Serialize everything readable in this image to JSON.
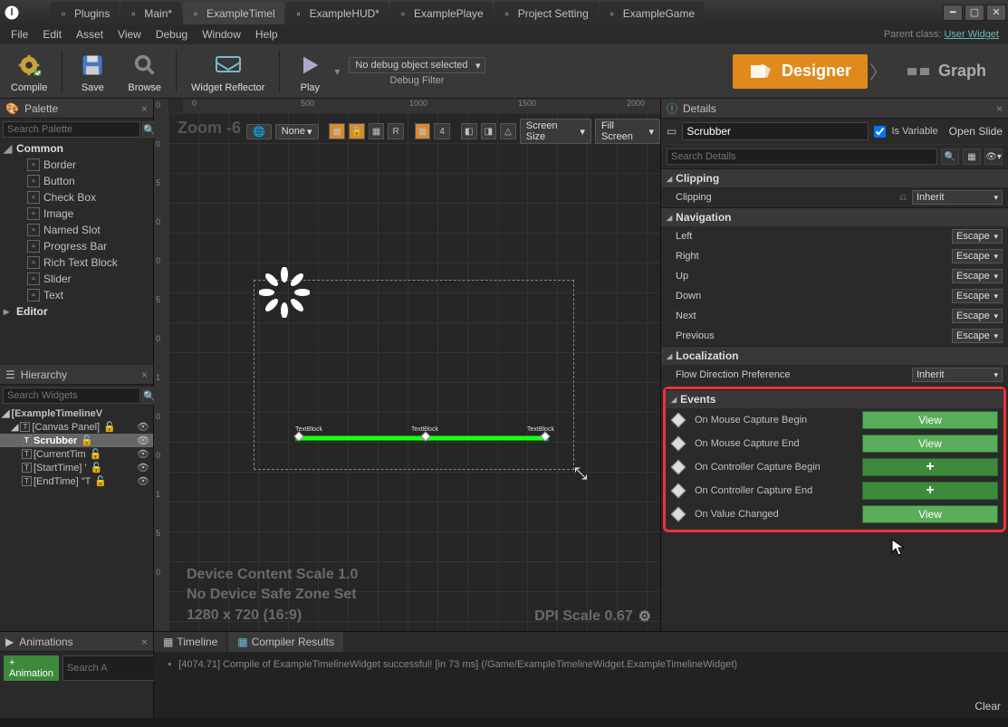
{
  "titlebar": {
    "tabs": [
      {
        "label": "Plugins",
        "icon": "plugin"
      },
      {
        "label": "Main*",
        "icon": "level"
      },
      {
        "label": "ExampleTimel",
        "icon": "widget",
        "active": true
      },
      {
        "label": "ExampleHUD*",
        "icon": "widget"
      },
      {
        "label": "ExamplePlaye",
        "icon": "bp"
      },
      {
        "label": "Project Setting",
        "icon": "settings"
      },
      {
        "label": "ExampleGame",
        "icon": "bp"
      }
    ]
  },
  "menus": [
    "File",
    "Edit",
    "Asset",
    "View",
    "Debug",
    "Window",
    "Help"
  ],
  "parent_class_label": "Parent class:",
  "parent_class": "User Widget",
  "toolbar": {
    "compile": "Compile",
    "save": "Save",
    "browse": "Browse",
    "reflector": "Widget Reflector",
    "play": "Play",
    "debug_select": "No debug object selected",
    "debug_filter": "Debug Filter",
    "designer": "Designer",
    "graph": "Graph"
  },
  "palette": {
    "title": "Palette",
    "search_placeholder": "Search Palette",
    "category": "Common",
    "items": [
      "Border",
      "Button",
      "Check Box",
      "Image",
      "Named Slot",
      "Progress Bar",
      "Rich Text Block",
      "Slider",
      "Text"
    ],
    "editor": "Editor"
  },
  "hierarchy": {
    "title": "Hierarchy",
    "search_placeholder": "Search Widgets",
    "root": "[ExampleTimelineV",
    "items": [
      {
        "label": "[Canvas Panel]",
        "indent": 1,
        "eye": true,
        "lock": true
      },
      {
        "label": "Scrubber",
        "indent": 2,
        "eye": true,
        "lock": true,
        "selected": true
      },
      {
        "label": "[CurrentTim",
        "indent": 2,
        "eye": true,
        "lock": true
      },
      {
        "label": "[StartTime] '",
        "indent": 2,
        "eye": true,
        "lock": true
      },
      {
        "label": "[EndTime] \"T",
        "indent": 2,
        "eye": true,
        "lock": true
      }
    ]
  },
  "viewport": {
    "zoom": "Zoom -6",
    "none": "None",
    "screen_size": "Screen Size",
    "fill_screen": "Fill Screen",
    "info1": "Device Content Scale 1.0",
    "info2": "No Device Safe Zone Set",
    "info3": "1280 x 720 (16:9)",
    "dpi": "DPI Scale 0.67",
    "ruler_top": [
      "0",
      "500",
      "1000",
      "1500",
      "2000"
    ],
    "ruler_left": [
      "0",
      "0",
      "5",
      "0",
      "0",
      "5",
      "0",
      "1",
      "0",
      "0",
      "1",
      "5",
      "0"
    ],
    "text_labels": [
      "TextBlock",
      "TextBlock",
      "TextBlock"
    ],
    "strip_num": "4"
  },
  "details": {
    "title": "Details",
    "name": "Scrubber",
    "is_variable": "Is Variable",
    "open_slide": "Open Slide",
    "search_placeholder": "Search Details",
    "clipping": {
      "cat": "Clipping",
      "label": "Clipping",
      "value": "Inherit"
    },
    "navigation": {
      "cat": "Navigation",
      "rows": [
        {
          "label": "Left",
          "value": "Escape"
        },
        {
          "label": "Right",
          "value": "Escape"
        },
        {
          "label": "Up",
          "value": "Escape"
        },
        {
          "label": "Down",
          "value": "Escape"
        },
        {
          "label": "Next",
          "value": "Escape"
        },
        {
          "label": "Previous",
          "value": "Escape"
        }
      ]
    },
    "localization": {
      "cat": "Localization",
      "label": "Flow Direction Preference",
      "value": "Inherit"
    },
    "events": {
      "cat": "Events",
      "rows": [
        {
          "label": "On Mouse Capture Begin",
          "btn": "View"
        },
        {
          "label": "On Mouse Capture End",
          "btn": "View"
        },
        {
          "label": "On Controller Capture Begin",
          "btn": "+"
        },
        {
          "label": "On Controller Capture End",
          "btn": "+"
        },
        {
          "label": "On Value Changed",
          "btn": "View"
        }
      ]
    }
  },
  "animations": {
    "title": "Animations",
    "add": "+ Animation",
    "search_placeholder": "Search A"
  },
  "bottom_tabs": {
    "timeline": "Timeline",
    "compiler": "Compiler Results"
  },
  "log": "[4074.71] Compile of ExampleTimelineWidget successful! [in 73 ms] (/Game/ExampleTimelineWidget.ExampleTimelineWidget)",
  "clear": "Clear"
}
